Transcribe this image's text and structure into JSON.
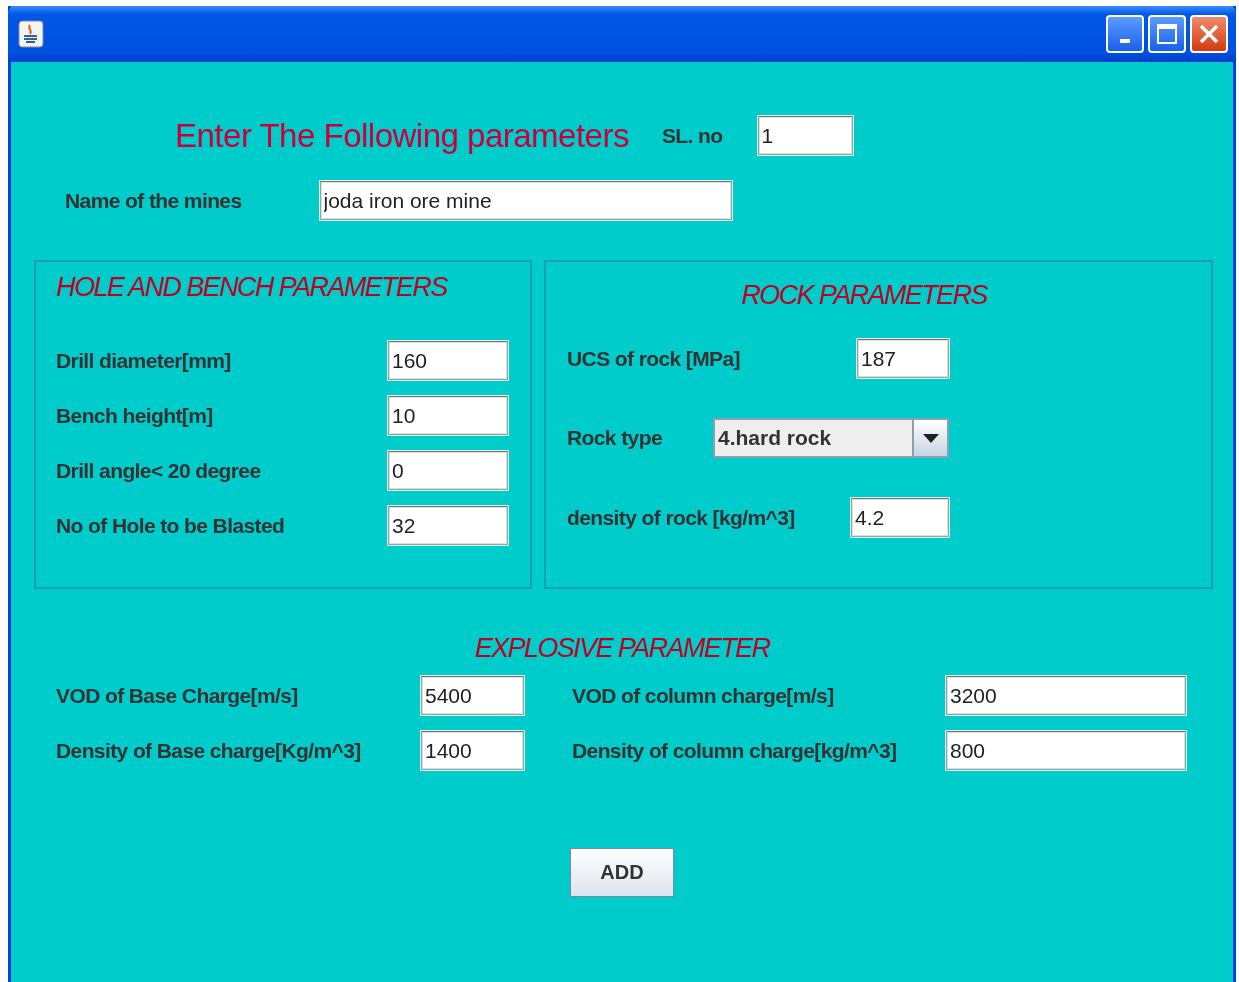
{
  "heading": "Enter The Following parameters",
  "sl_no": {
    "label": "SL. no",
    "value": "1"
  },
  "mine_name": {
    "label": "Name of the mines",
    "value": "joda iron ore mine"
  },
  "hole_and_bench": {
    "title": "HOLE AND BENCH PARAMETERS",
    "fields": [
      {
        "label": "Drill diameter[mm]",
        "value": "160"
      },
      {
        "label": "Bench height[m]",
        "value": "10"
      },
      {
        "label": "Drill angle< 20 degree",
        "value": "0"
      },
      {
        "label": "No of Hole to be Blasted",
        "value": "32"
      }
    ]
  },
  "rock": {
    "title": "ROCK PARAMETERS",
    "fields": [
      {
        "kind": "text",
        "label": "UCS of rock [MPa]",
        "value": "187"
      },
      {
        "kind": "dropdown",
        "label": "Rock type",
        "value": "4.hard rock"
      },
      {
        "kind": "text",
        "label": "density of rock [kg/m^3]",
        "value": "4.2"
      }
    ]
  },
  "explosive": {
    "title": "EXPLOSIVE PARAMETER",
    "fields": [
      {
        "label": "VOD of Base Charge[m/s]",
        "value": "5400"
      },
      {
        "label": "VOD of column charge[m/s]",
        "value": "3200"
      },
      {
        "label": "Density of Base charge[Kg/m^3]",
        "value": "1400"
      },
      {
        "label": "Density of column charge[kg/m^3]",
        "value": "800"
      }
    ]
  },
  "buttons": [
    "ADD"
  ]
}
